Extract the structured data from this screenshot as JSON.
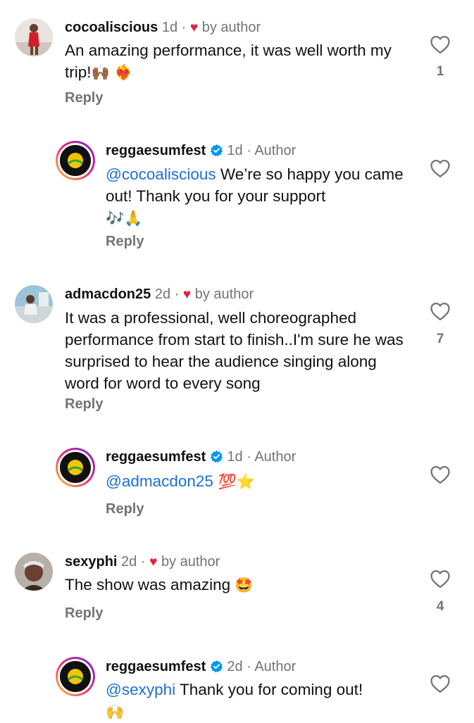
{
  "comments": [
    {
      "username": "cocoaliscious",
      "time": "1d",
      "badge": "by author",
      "text": "An amazing performance, it was well worth my trip!",
      "emoji": "🙌🏾 ❤️‍🔥",
      "reply_label": "Reply",
      "likes": "1"
    },
    {
      "username": "reggaesumfest",
      "time": "1d",
      "role": "Author",
      "mention": "@cocoaliscious",
      "text": " We’re so happy you came out! Thank you for your support",
      "emoji": "🎶🙏",
      "reply_label": "Reply"
    },
    {
      "username": "admacdon25",
      "time": "2d",
      "badge": "by author",
      "text": "It was a professional, well choreographed performance from start to finish..I'm sure he was surprised to hear the audience singing along word for word to every song",
      "reply_label": "Reply",
      "likes": "7"
    },
    {
      "username": "reggaesumfest",
      "time": "1d",
      "role": "Author",
      "mention": "@admacdon25",
      "emoji": " 💯⭐",
      "reply_label": "Reply"
    },
    {
      "username": "sexyphi",
      "time": "2d",
      "badge": "by author",
      "text": "The show was amazing",
      "emoji": "🤩",
      "reply_label": "Reply",
      "likes": "4"
    },
    {
      "username": "reggaesumfest",
      "time": "2d",
      "role": "Author",
      "mention": "@sexyphi",
      "text": " Thank you for coming out!",
      "emoji": "🙌"
    }
  ],
  "colors": {
    "mention": "#1b6fd6",
    "muted": "#737373",
    "heart": "#ed1c3c",
    "verified": "#0095f6"
  },
  "icons": {
    "like": "heart-outline-icon",
    "author_liked": "red-heart-icon",
    "verified": "verified-badge-icon"
  }
}
